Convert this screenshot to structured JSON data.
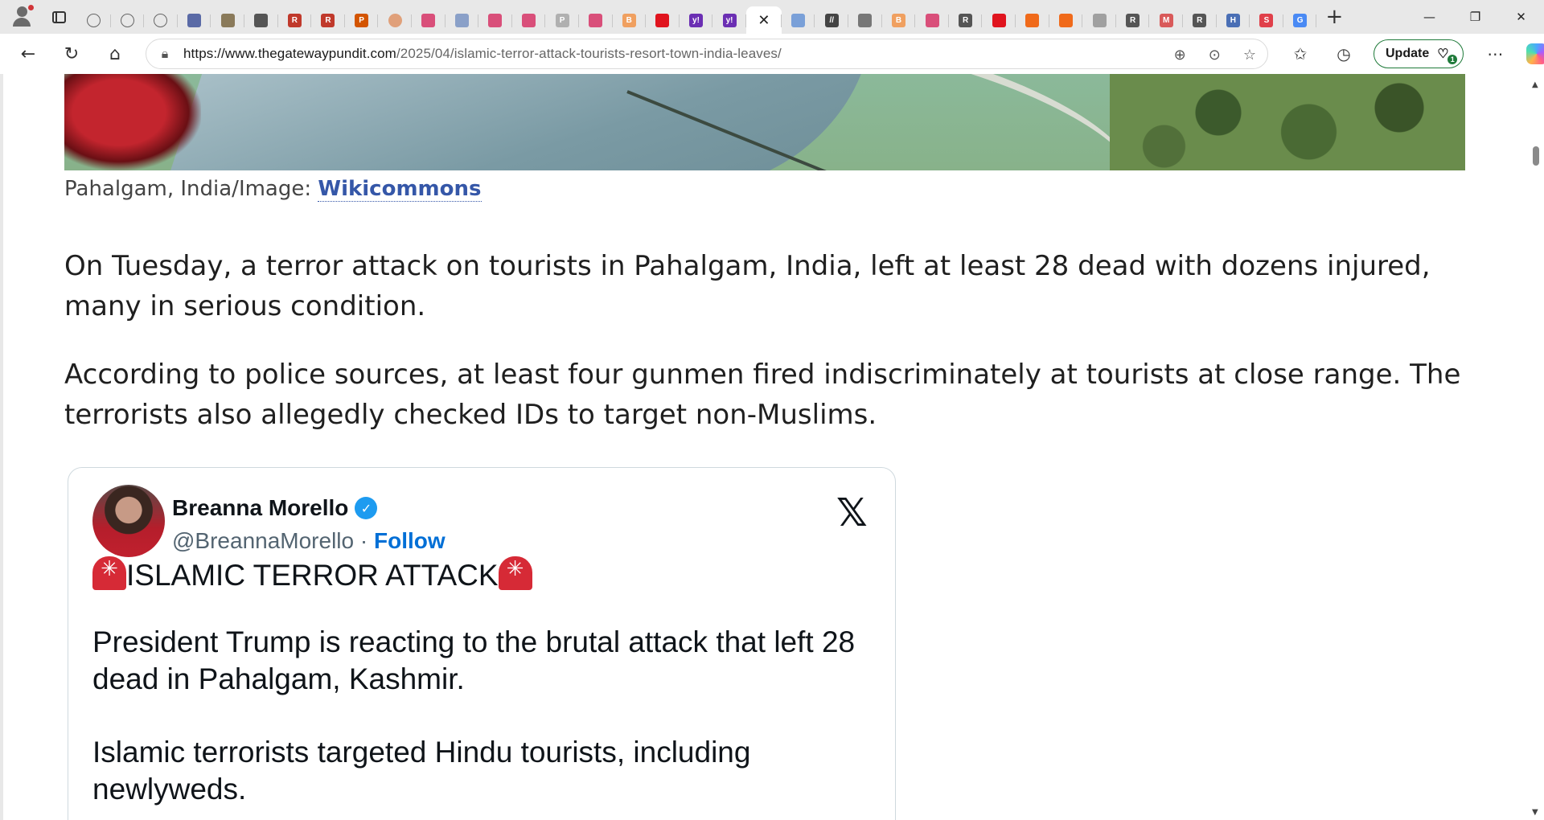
{
  "browser": {
    "url_host": "https://www.thegatewaypundit.com",
    "url_path": "/2025/04/islamic-terror-attack-tourists-resort-town-india-leaves/",
    "update_label": "Update",
    "update_badge": "1",
    "tabs": [
      {
        "icon": "globe-icon",
        "color": ""
      },
      {
        "icon": "globe-icon",
        "color": ""
      },
      {
        "icon": "globe-icon",
        "color": ""
      },
      {
        "icon": "newspaper-icon",
        "color": "#5a6aa6"
      },
      {
        "icon": "folder-icon",
        "color": "#8a7a5a"
      },
      {
        "icon": "play-icon",
        "color": "#555555"
      },
      {
        "icon": "r-icon",
        "color": "#c0392b",
        "text": "R"
      },
      {
        "icon": "r-icon",
        "color": "#c0392b",
        "text": "R"
      },
      {
        "icon": "pdf-icon",
        "color": "#d35400",
        "text": "P"
      },
      {
        "icon": "circle-icon",
        "color": "#e0a07a"
      },
      {
        "icon": "video-icon",
        "color": "#d94f7a"
      },
      {
        "icon": "chart-icon",
        "color": "#8aa0c8"
      },
      {
        "icon": "video-icon",
        "color": "#d94f7a"
      },
      {
        "icon": "video-icon",
        "color": "#d94f7a"
      },
      {
        "icon": "pdf-icon",
        "color": "#b0b0b0",
        "text": "P"
      },
      {
        "icon": "video-icon",
        "color": "#d94f7a"
      },
      {
        "icon": "blogger-icon",
        "color": "#f0a060",
        "text": "B"
      },
      {
        "icon": "youtube-icon",
        "color": "#e0141e"
      },
      {
        "icon": "yahoo-icon",
        "color": "#6b2fb3",
        "text": "y!"
      },
      {
        "icon": "yahoo-icon",
        "color": "#6b2fb3",
        "text": "y!"
      },
      {
        "icon": "search-icon",
        "color": "#7aa0d8"
      },
      {
        "icon": "slash-icon",
        "color": "#444444",
        "text": "//"
      },
      {
        "icon": "chart-icon",
        "color": "#777777"
      },
      {
        "icon": "blogger-icon",
        "color": "#f0a060",
        "text": "B"
      },
      {
        "icon": "video-icon",
        "color": "#d94f7a"
      },
      {
        "icon": "r-icon",
        "color": "#555555",
        "text": "R"
      },
      {
        "icon": "youtube-icon",
        "color": "#e0141e"
      },
      {
        "icon": "bookmark-icon",
        "color": "#f06a1a"
      },
      {
        "icon": "bookmark-icon",
        "color": "#f06a1a"
      },
      {
        "icon": "image-icon",
        "color": "#a0a0a0"
      },
      {
        "icon": "r-icon",
        "color": "#555555",
        "text": "R"
      },
      {
        "icon": "m-icon",
        "color": "#d95a5a",
        "text": "M"
      },
      {
        "icon": "r-icon",
        "color": "#555555",
        "text": "R"
      },
      {
        "icon": "h-icon",
        "color": "#4a6fb5",
        "text": "H"
      },
      {
        "icon": "s-icon",
        "color": "#e0404a",
        "text": "S"
      },
      {
        "icon": "google-icon",
        "color": "#4a8af4",
        "text": "G"
      }
    ]
  },
  "article": {
    "caption_text": "Pahalgam, India/Image: ",
    "caption_link": "Wikicommons",
    "paragraph1": "On Tuesday, a terror attack on tourists in Pahalgam, India, left at least 28 dead with dozens injured, many in serious condition.",
    "paragraph2": "According to police sources, at least four gunmen fired indiscriminately at tourists at close range.  The terrorists also allegedly checked IDs to target non-Muslims."
  },
  "tweet": {
    "name": "Breanna Morello",
    "handle": "@BreannaMorello",
    "separator": " · ",
    "follow_label": "Follow",
    "headline": "ISLAMIC TERROR ATTACK",
    "line2": "President Trump is reacting to the brutal attack that left 28 dead in Pahalgam, Kashmir.",
    "line3": "Islamic terrorists targeted Hindu tourists, including newlyweds."
  }
}
